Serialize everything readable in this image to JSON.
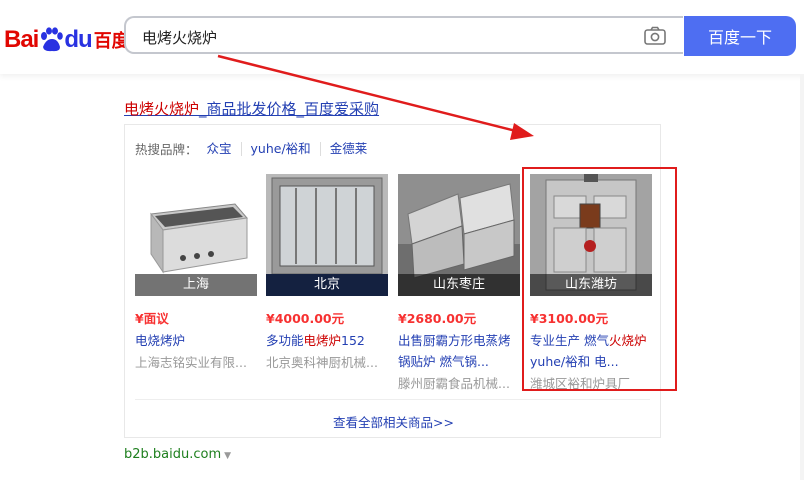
{
  "header": {
    "logo_bai": "Bai",
    "logo_du": "du",
    "logo_cn": "百度",
    "search_value": "电烤火烧炉",
    "search_button": "百度一下"
  },
  "result": {
    "title_highlight": "电烤火烧炉",
    "title_rest": "_商品批发价格_百度爱采购",
    "hot_label": "热搜品牌：",
    "brands": [
      "众宝",
      "yuhe/裕和",
      "金德莱"
    ],
    "products": [
      {
        "location": "上海",
        "price": "¥面议",
        "name_plain": "电烧烤炉",
        "name_hl": "",
        "name_tail": "",
        "shop": "上海志铭实业有限..."
      },
      {
        "location": "北京",
        "price": "¥4000.00元",
        "name_plain": "多功能",
        "name_hl": "电烤炉",
        "name_tail": "152",
        "shop": "北京奥科神厨机械..."
      },
      {
        "location": "山东枣庄",
        "price": "¥2680.00元",
        "name_plain": "出售厨霸方形电蒸烤锅贴炉 燃气锅...",
        "name_hl": "",
        "name_tail": "",
        "shop": "滕州厨霸食品机械..."
      },
      {
        "location": "山东潍坊",
        "price": "¥3100.00元",
        "name_plain": "专业生产 燃气",
        "name_hl": "火烧炉",
        "name_tail": " yuhe/裕和 电...",
        "shop": "潍城区裕和炉具厂"
      }
    ],
    "view_all": "查看全部相关商品>>",
    "url": "b2b.baidu.com"
  },
  "colors": {
    "accent": "#4e6ef2",
    "link": "#2440b3",
    "highlight": "#c00",
    "price": "#f73131",
    "annotation": "#e01c1c"
  }
}
